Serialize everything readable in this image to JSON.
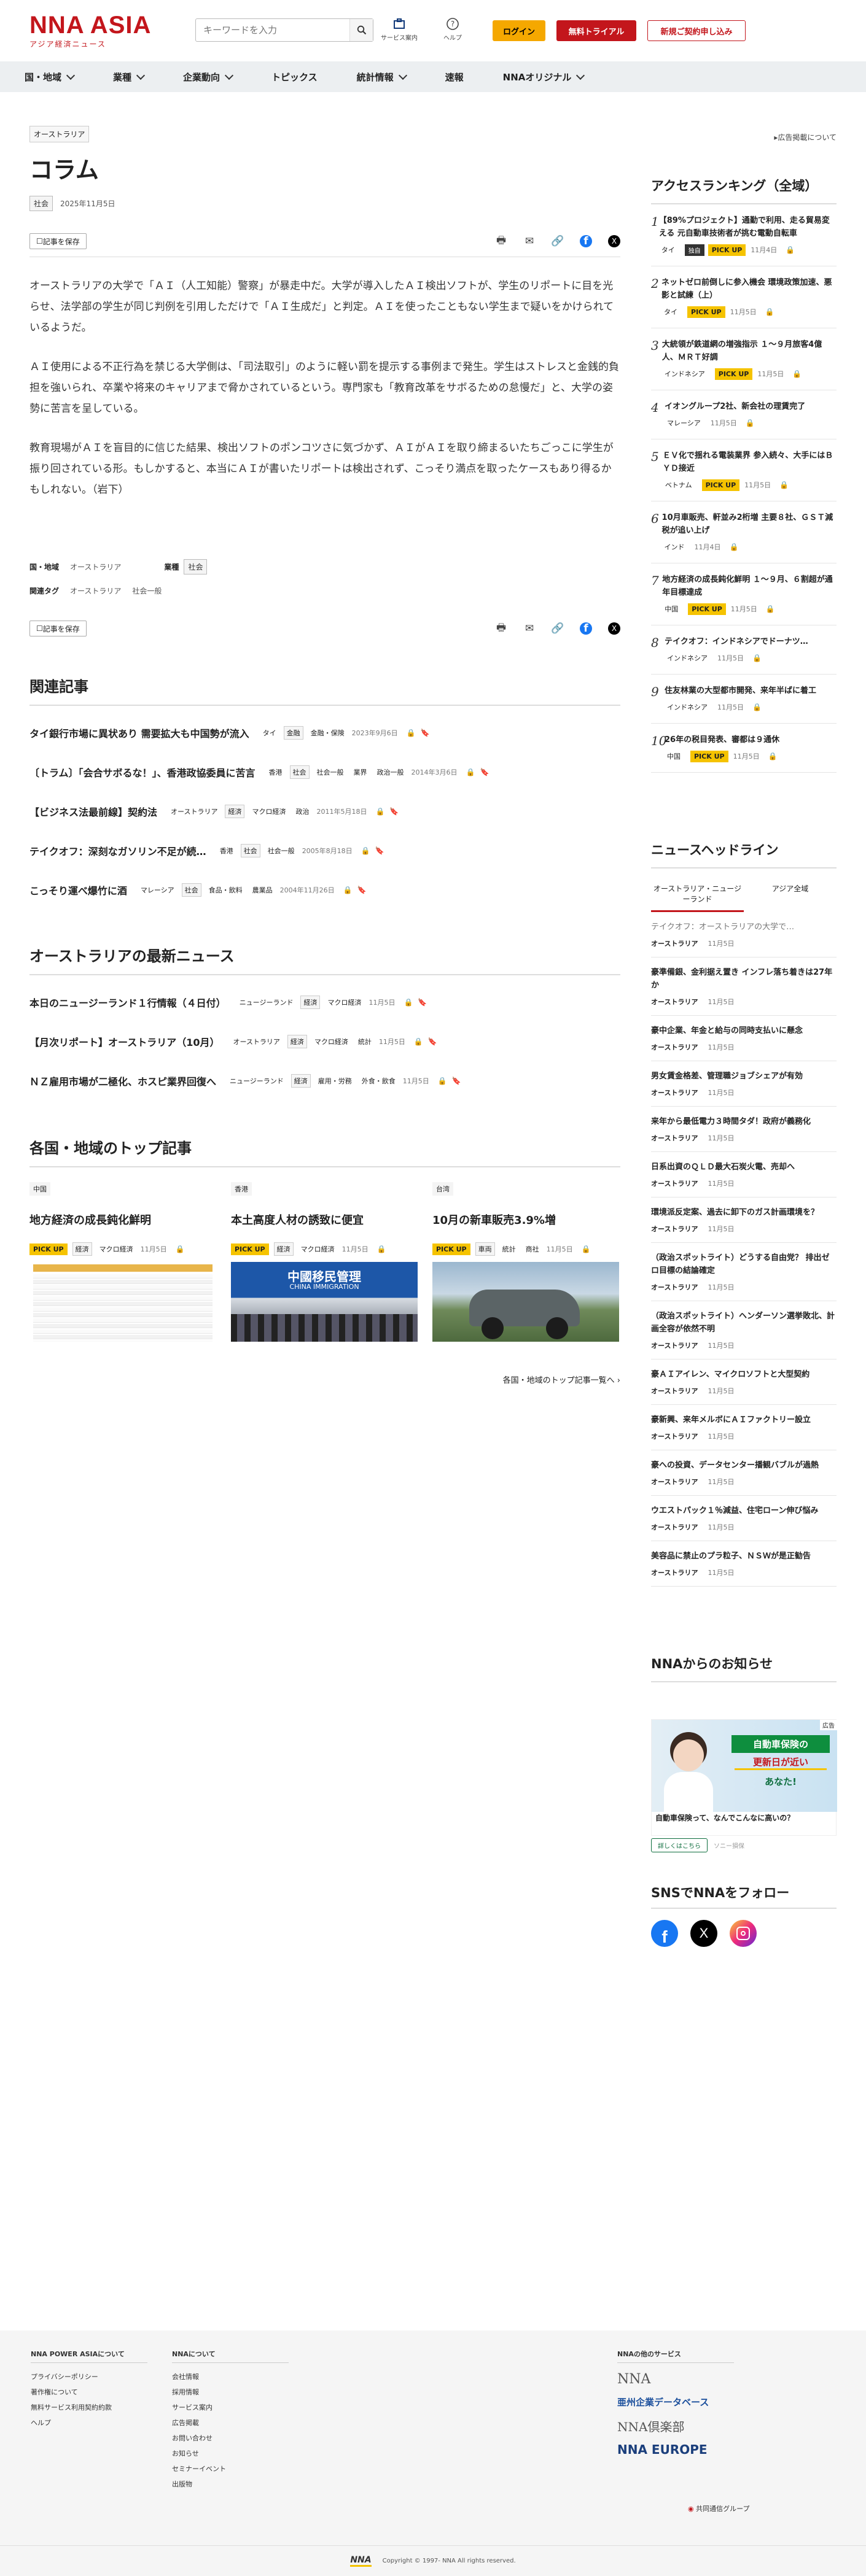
{
  "header": {
    "logo": "NNA ASIA",
    "logo_sub": "アジア経済ニュース",
    "search_placeholder": "キーワードを入力",
    "service_label": "サービス案内",
    "help_label": "ヘルプ",
    "login": "ログイン",
    "trial": "無料トライアル",
    "signup": "新規ご契約申し込み"
  },
  "nav": [
    "国・地域",
    "業種",
    "企業動向",
    "トピックス",
    "統計情報",
    "速報",
    "NNAオリジナル"
  ],
  "article": {
    "country_tag": "オーストラリア",
    "title": "コラム",
    "category": "社会",
    "date": "2025年11月5日",
    "save_label": "記事を保存",
    "paragraphs": [
      "オーストラリアの大学で「ＡＩ（人工知能）警察」が暴走中だ。大学が導入したＡＩ検出ソフトが、学生のリポートに目を光らせ、法学部の学生が同じ判例を引用しただけで「ＡＩ生成だ」と判定。ＡＩを使ったこともない学生まで疑いをかけられているようだ。",
      "ＡＩ使用による不正行為を禁じる大学側は、「司法取引」のように軽い罰を提示する事例まで発生。学生はストレスと金銭的負担を強いられ、卒業や将来のキャリアまで脅かされているという。専門家も「教育改革をサボるための怠慢だ」と、大学の姿勢に苦言を呈している。",
      "教育現場がＡＩを盲目的に信じた結果、検出ソフトのポンコツさに気づかず、ＡＩがＡＩを取り締まるいたちごっこに学生が振り回されている形。もしかすると、本当にＡＩが書いたリポートは検出されず、こっそり満点を取ったケースもあり得るかもしれない。（岩下）"
    ],
    "info": {
      "country_label": "国・地域",
      "country_value": "オーストラリア",
      "industry_label": "業種",
      "industry_value": "社会",
      "tags_label": "関連タグ",
      "tags": [
        "オーストラリア",
        "社会一般"
      ]
    }
  },
  "related": {
    "heading": "関連記事",
    "items": [
      {
        "title": "タイ銀行市場に異状あり 需要拡大も中国勢が流入",
        "country": "タイ",
        "tags": [
          "金融",
          "金融・保険"
        ],
        "date": "2023年9月6日"
      },
      {
        "title": "〔トラム〕「会合サボるな！」、香港政協委員に苦言",
        "country": "香港",
        "tags": [
          "社会",
          "社会一般",
          "業界",
          "政治一般"
        ],
        "date": "2014年3月6日"
      },
      {
        "title": "【ビジネス法最前線】契約法",
        "country": "オーストラリア",
        "tags": [
          "経済",
          "マクロ経済",
          "政治"
        ],
        "date": "2011年5月18日"
      },
      {
        "title": "テイクオフ：深刻なガソリン不足が続…",
        "country": "香港",
        "tags": [
          "社会",
          "社会一般"
        ],
        "date": "2005年8月18日"
      },
      {
        "title": "こっそり運べ爆竹に酒",
        "country": "マレーシア",
        "tags": [
          "社会",
          "食品・飲料",
          "農業品"
        ],
        "date": "2004年11月26日"
      }
    ]
  },
  "latest": {
    "heading": "オーストラリアの最新ニュース",
    "items": [
      {
        "title": "本日のニュージーランド１行情報（４日付）",
        "country": "ニュージーランド",
        "tags": [
          "経済",
          "マクロ経済"
        ],
        "date": "11月5日"
      },
      {
        "title": "【月次リポート】オーストラリア（10月）",
        "country": "オーストラリア",
        "tags": [
          "経済",
          "マクロ経済",
          "統計"
        ],
        "date": "11月5日"
      },
      {
        "title": "ＮＺ雇用市場が二極化、ホスピ業界回復へ",
        "country": "ニュージーランド",
        "tags": [
          "経済",
          "雇用・労務",
          "外食・飲食"
        ],
        "date": "11月5日"
      }
    ]
  },
  "top": {
    "heading": "各国・地域のトップ記事",
    "more": "各国・地域のトップ記事一覧へ",
    "cards": [
      {
        "region": "中国",
        "title": "地方経済の成長鈍化鮮明",
        "tags": [
          "経済",
          "マクロ経済"
        ],
        "date": "11月5日"
      },
      {
        "region": "香港",
        "title": "本土高度人材の誘致に便宜",
        "tags": [
          "経済",
          "マクロ経済"
        ],
        "date": "11月5日",
        "img_text_cn": "中國移民管理",
        "img_text_en": "CHINA IMMIGRATION"
      },
      {
        "region": "台湾",
        "title": "10月の新車販売3.9%増",
        "tags": [
          "車両",
          "統計",
          "商社"
        ],
        "date": "11月5日"
      }
    ]
  },
  "sidebar": {
    "ad_link": "広告掲載について",
    "ranking_heading": "アクセスランキング（全域）",
    "pickup": "PICK UP",
    "exclusive": "独自",
    "ranking": [
      {
        "n": "1",
        "title": "【89%プロジェクト】通勤で利用、走る貿易変える 元自動車技術者が挑む電動自転車",
        "meta": [
          "タイ",
          "独自",
          "PICK UP",
          "11月4日"
        ]
      },
      {
        "n": "2",
        "title": "ネットゼロ前倒しに参入機会 環境政策加速、悪影と試練（上）",
        "meta": [
          "タイ",
          "PICK UP",
          "11月5日"
        ]
      },
      {
        "n": "3",
        "title": "大統領が鉄道網の増強指示 １〜９月旅客4億人、ＭＲＴ好調",
        "meta": [
          "インドネシア",
          "PICK UP",
          "11月5日"
        ]
      },
      {
        "n": "4",
        "title": "イオングループ2社、新会社の理賃完了",
        "meta": [
          "マレーシア",
          "11月5日"
        ]
      },
      {
        "n": "5",
        "title": "ＥＶ化で揺れる電装業界 参入続々、大手にはＢＹＤ接近",
        "meta": [
          "ベトナム",
          "PICK UP",
          "11月5日"
        ]
      },
      {
        "n": "6",
        "title": "10月車販売、軒並み2桁増 主要８社、ＧＳＴ減税が追い上げ",
        "meta": [
          "インド",
          "11月4日"
        ]
      },
      {
        "n": "7",
        "title": "地方経済の成長鈍化鮮明 １〜９月、６割超が通年目標達成",
        "meta": [
          "中国",
          "PICK UP",
          "11月5日"
        ]
      },
      {
        "n": "8",
        "title": "テイクオフ：インドネシアでドーナツ…",
        "meta": [
          "インドネシア",
          "11月5日"
        ]
      },
      {
        "n": "9",
        "title": "住友林業の大型都市開発、来年半ばに着工",
        "meta": [
          "インドネシア",
          "11月5日"
        ]
      },
      {
        "n": "10",
        "title": "26年の税目発表、審都は９通休",
        "meta": [
          "中国",
          "PICK UP",
          "11月5日"
        ]
      }
    ],
    "headline_heading": "ニュースヘッドライン",
    "tabs": [
      "オーストラリア・ニュージーランド",
      "アジア全域"
    ],
    "headlines": [
      {
        "title": "テイクオフ：オーストラリアの大学で…",
        "country": "オーストラリア",
        "date": "11月5日",
        "faded": true
      },
      {
        "title": "豪準備銀、金利据え置き インフレ落ち着きは27年か",
        "country": "オーストラリア",
        "date": "11月5日"
      },
      {
        "title": "豪中企業、年金と給与の同時支払いに懸念",
        "country": "オーストラリア",
        "date": "11月5日"
      },
      {
        "title": "男女賃金格差、管理職ジョブシェアが有効",
        "country": "オーストラリア",
        "date": "11月5日"
      },
      {
        "title": "来年から最低電力３時間タダ！政府が義務化",
        "country": "オーストラリア",
        "date": "11月5日"
      },
      {
        "title": "日系出資のＱＬＤ最大石炭火電、売却へ",
        "country": "オーストラリア",
        "date": "11月5日"
      },
      {
        "title": "環境派反定案、過去に卸下のガス計画環境を？",
        "country": "オーストラリア",
        "date": "11月5日"
      },
      {
        "title": "（政治スポットライト）どうする自由党？ 排出ゼロ目標の結論確定",
        "country": "オーストラリア",
        "date": "11月5日"
      },
      {
        "title": "（政治スポットライト）ヘンダーソン選挙敗北、計画全容が依然不明",
        "country": "オーストラリア",
        "date": "11月5日"
      },
      {
        "title": "豪ＡＩアイレン、マイクロソフトと大型契約",
        "country": "オーストラリア",
        "date": "11月5日"
      },
      {
        "title": "豪新興、来年メルボにＡＩファクトリー設立",
        "country": "オーストラリア",
        "date": "11月5日"
      },
      {
        "title": "豪への投資、データセンター播観バブルが過熱",
        "country": "オーストラリア",
        "date": "11月5日"
      },
      {
        "title": "ウエストパック１％減益、住宅ローン伸び悩み",
        "country": "オーストラリア",
        "date": "11月5日"
      },
      {
        "title": "美容品に禁止のプラ粒子、ＮＳＷが是正勧告",
        "country": "オーストラリア",
        "date": "11月5日"
      }
    ],
    "notice_heading": "NNAからのお知らせ",
    "ad": {
      "badge": "広告",
      "l1": "自動車保険の",
      "l2": "更新日が近い",
      "l3": "あなた!",
      "caption": "自動車保険って、なんでこんなに高いの？",
      "cta": "詳しくはこちら",
      "brand": "ソニー損保"
    },
    "sns_heading": "SNSでNNAをフォロー"
  },
  "footer": {
    "col1_head": "NNA POWER ASIAについて",
    "col1": [
      "プライバシーポリシー",
      "著作権について",
      "無料サービス利用契約約款",
      "ヘルプ"
    ],
    "col2_head": "NNAについて",
    "col2": [
      "会社情報",
      "採用情報",
      "サービス案内",
      "広告掲載",
      "お問い合わせ",
      "お知らせ",
      "セミナーイベント",
      "出版物"
    ],
    "col3_head": "NNAの他のサービス",
    "services": [
      "NNA",
      "亜州企業データベース",
      "NNA倶楽部",
      "NNA EUROPE"
    ],
    "group": "共同通信グループ",
    "copyright": "Copyright © 1997- NNA All rights reserved."
  }
}
